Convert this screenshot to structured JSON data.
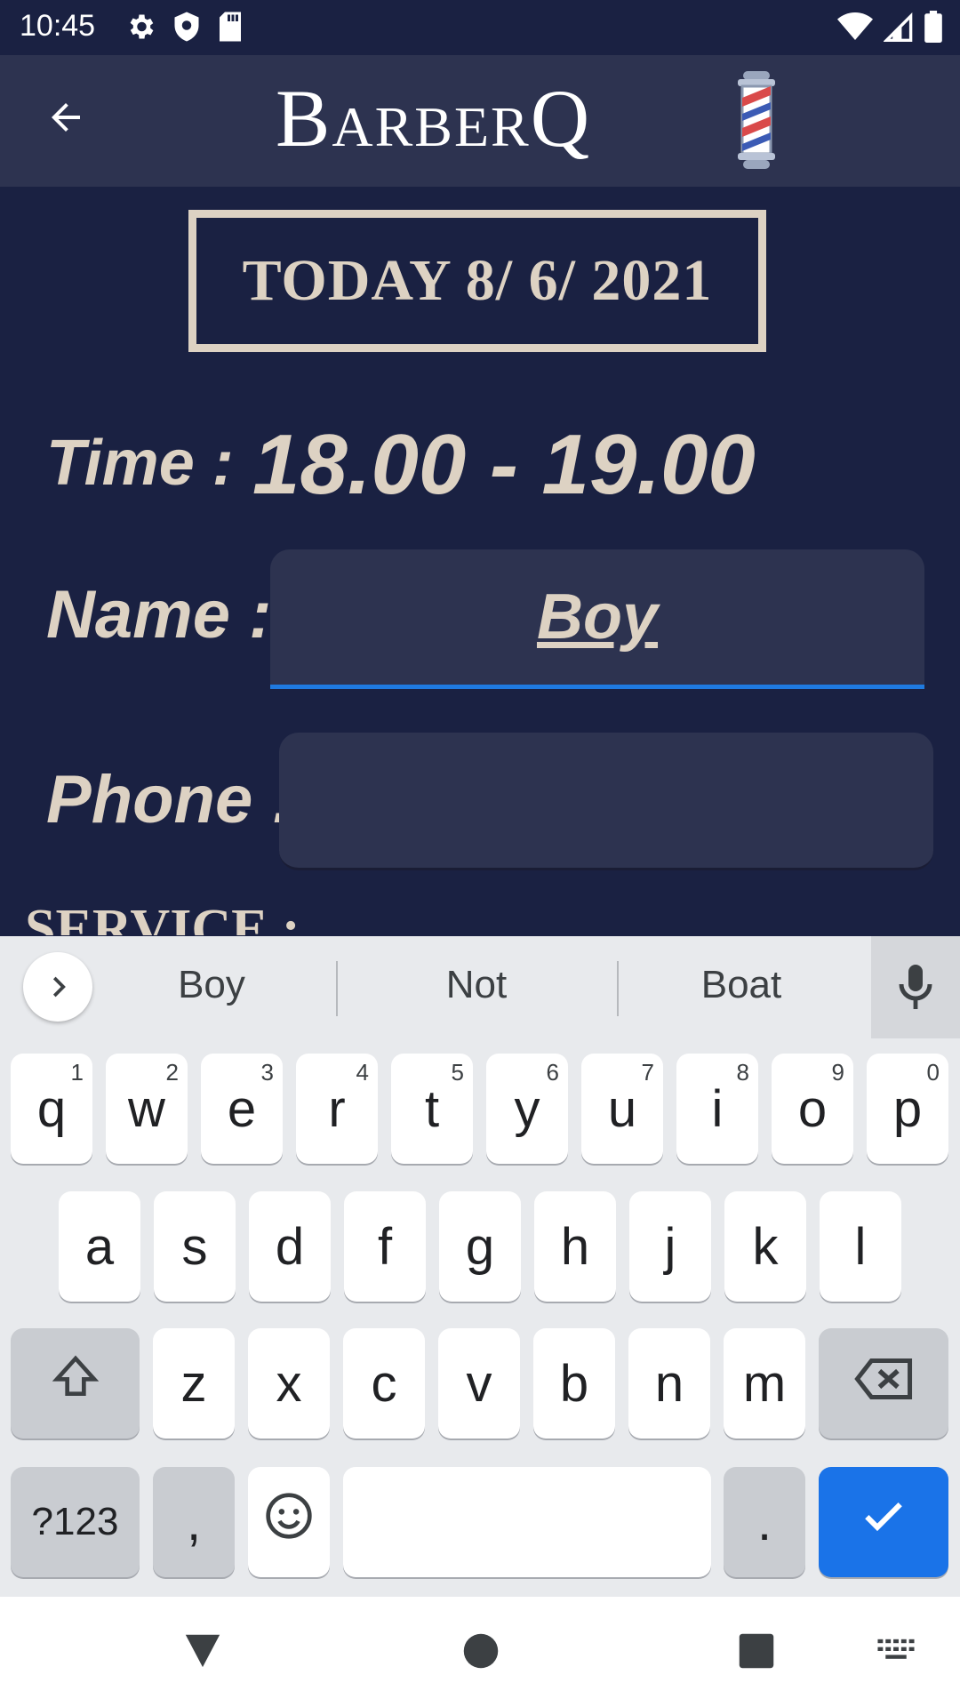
{
  "status_bar": {
    "time": "10:45",
    "left_icons": [
      "settings-icon",
      "shield-icon",
      "sd-card-icon"
    ],
    "right_icons": [
      "wifi-icon",
      "cell-signal-icon",
      "battery-icon"
    ]
  },
  "app_bar": {
    "title": "BarberQ",
    "logo_icon": "barber-pole-icon",
    "back_icon": "arrow-back-icon"
  },
  "date_box": {
    "text": "TODAY 8/ 6/ 2021"
  },
  "time_row": {
    "label": "Time :",
    "value": "18.00 - 19.00"
  },
  "name_row": {
    "label": "Name :",
    "value": "Boy"
  },
  "phone_row": {
    "label": "Phone :",
    "value": ""
  },
  "service_label": "SERVICE :",
  "keyboard": {
    "suggestions": [
      "Boy",
      "Not",
      "Boat"
    ],
    "row1": [
      {
        "k": "q",
        "h": "1"
      },
      {
        "k": "w",
        "h": "2"
      },
      {
        "k": "e",
        "h": "3"
      },
      {
        "k": "r",
        "h": "4"
      },
      {
        "k": "t",
        "h": "5"
      },
      {
        "k": "y",
        "h": "6"
      },
      {
        "k": "u",
        "h": "7"
      },
      {
        "k": "i",
        "h": "8"
      },
      {
        "k": "o",
        "h": "9"
      },
      {
        "k": "p",
        "h": "0"
      }
    ],
    "row2": [
      "a",
      "s",
      "d",
      "f",
      "g",
      "h",
      "j",
      "k",
      "l"
    ],
    "row3": [
      "z",
      "x",
      "c",
      "v",
      "b",
      "n",
      "m"
    ],
    "symbols_label": "?123",
    "comma_label": ",",
    "period_label": "."
  },
  "colors": {
    "background": "#1a2142",
    "app_bar": "#2d3350",
    "accent_text": "#ddd2c3",
    "focus_underline": "#1f7ae0",
    "enter_key": "#1a73e8"
  }
}
